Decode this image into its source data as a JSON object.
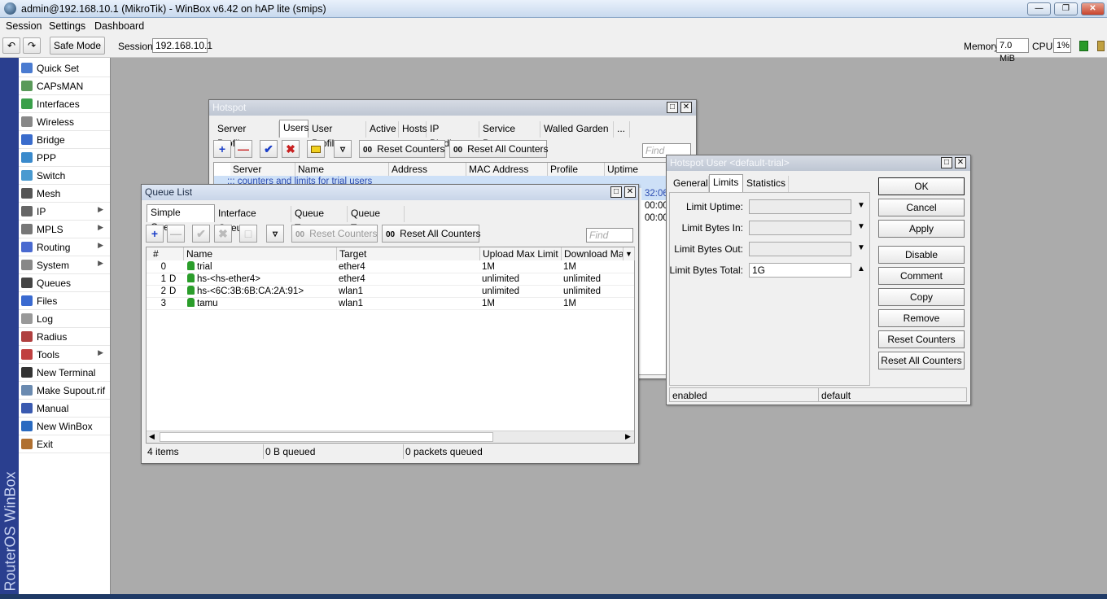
{
  "window": {
    "title": "admin@192.168.10.1 (MikroTik) - WinBox v6.42 on hAP lite (smips)"
  },
  "menu": [
    "Session",
    "Settings",
    "Dashboard"
  ],
  "toolbar": {
    "safe_mode": "Safe Mode",
    "session_label": "Session:",
    "session_value": "192.168.10.1",
    "memory_label": "Memory:",
    "memory_value": "7.0 MiB",
    "cpu_label": "CPU:",
    "cpu_value": "1%"
  },
  "side_brand": "RouterOS WinBox",
  "sidebar": [
    {
      "label": "Quick Set",
      "icon": "quickset-icon",
      "color": "#4a7bd0",
      "arrow": ""
    },
    {
      "label": "CAPsMAN",
      "icon": "capsman-icon",
      "color": "#5a9a5a",
      "arrow": ""
    },
    {
      "label": "Interfaces",
      "icon": "interfaces-icon",
      "color": "#3aa04a",
      "arrow": ""
    },
    {
      "label": "Wireless",
      "icon": "wireless-icon",
      "color": "#888888",
      "arrow": ""
    },
    {
      "label": "Bridge",
      "icon": "bridge-icon",
      "color": "#3a6ccc",
      "arrow": ""
    },
    {
      "label": "PPP",
      "icon": "ppp-icon",
      "color": "#3a8acc",
      "arrow": ""
    },
    {
      "label": "Switch",
      "icon": "switch-icon",
      "color": "#4a9ad0",
      "arrow": ""
    },
    {
      "label": "Mesh",
      "icon": "mesh-icon",
      "color": "#555555",
      "arrow": ""
    },
    {
      "label": "IP",
      "icon": "ip-icon",
      "color": "#666666",
      "arrow": "▶"
    },
    {
      "label": "MPLS",
      "icon": "mpls-icon",
      "color": "#777777",
      "arrow": "▶"
    },
    {
      "label": "Routing",
      "icon": "routing-icon",
      "color": "#4a6ad0",
      "arrow": "▶"
    },
    {
      "label": "System",
      "icon": "system-icon",
      "color": "#888888",
      "arrow": "▶"
    },
    {
      "label": "Queues",
      "icon": "queues-icon",
      "color": "#444444",
      "arrow": ""
    },
    {
      "label": "Files",
      "icon": "files-icon",
      "color": "#3a6ad0",
      "arrow": ""
    },
    {
      "label": "Log",
      "icon": "log-icon",
      "color": "#999999",
      "arrow": ""
    },
    {
      "label": "Radius",
      "icon": "radius-icon",
      "color": "#b04040",
      "arrow": ""
    },
    {
      "label": "Tools",
      "icon": "tools-icon",
      "color": "#c04040",
      "arrow": "▶"
    },
    {
      "label": "New Terminal",
      "icon": "terminal-icon",
      "color": "#333333",
      "arrow": ""
    },
    {
      "label": "Make Supout.rif",
      "icon": "supout-icon",
      "color": "#6a8ab0",
      "arrow": ""
    },
    {
      "label": "Manual",
      "icon": "manual-icon",
      "color": "#3a5ab0",
      "arrow": ""
    },
    {
      "label": "New WinBox",
      "icon": "winbox-icon",
      "color": "#2a6ac0",
      "arrow": ""
    },
    {
      "label": "Exit",
      "icon": "exit-icon",
      "color": "#b07030",
      "arrow": ""
    }
  ],
  "hotspot": {
    "title": "Hotspot",
    "tabs": [
      "Server Profiles",
      "Users",
      "User Profiles",
      "Active",
      "Hosts",
      "IP Bindings",
      "Service Ports",
      "Walled Garden",
      "..."
    ],
    "reset_counters": "Reset Counters",
    "reset_all_counters": "Reset All Counters",
    "find_placeholder": "Find",
    "columns": [
      "Server",
      "Name",
      "Address",
      "MAC Address",
      "Profile",
      "Uptime"
    ],
    "comment_row": ";;; counters and limits for trial users",
    "uptime_fragments": [
      "32:06",
      "00:00",
      "00:00"
    ]
  },
  "queue": {
    "title": "Queue List",
    "tabs": [
      "Simple Queues",
      "Interface Queues",
      "Queue Tree",
      "Queue Types"
    ],
    "reset_counters": "Reset Counters",
    "reset_all_counters": "Reset All Counters",
    "find_placeholder": "Find",
    "columns": [
      "#",
      "Name",
      "Target",
      "Upload Max Limit",
      "Download Max"
    ],
    "rows": [
      {
        "num": "0",
        "flag": "",
        "name": "trial",
        "target": "ether4",
        "up": "1M",
        "down": "1M"
      },
      {
        "num": "1",
        "flag": "D",
        "name": "hs-<hs-ether4>",
        "target": "ether4",
        "up": "unlimited",
        "down": "unlimited"
      },
      {
        "num": "2",
        "flag": "D",
        "name": "hs-<6C:3B:6B:CA:2A:91>",
        "target": "wlan1",
        "up": "unlimited",
        "down": "unlimited"
      },
      {
        "num": "3",
        "flag": "",
        "name": "tamu",
        "target": "wlan1",
        "up": "1M",
        "down": "1M"
      }
    ],
    "status": {
      "items": "4 items",
      "queued": "0 B queued",
      "packets": "0 packets queued"
    }
  },
  "user_dialog": {
    "title": "Hotspot User <default-trial>",
    "tabs": [
      "General",
      "Limits",
      "Statistics"
    ],
    "fields": [
      {
        "label": "Limit Uptime:",
        "value": ""
      },
      {
        "label": "Limit Bytes In:",
        "value": ""
      },
      {
        "label": "Limit Bytes Out:",
        "value": ""
      },
      {
        "label": "Limit Bytes Total:",
        "value": "1G"
      }
    ],
    "buttons": [
      "OK",
      "Cancel",
      "Apply",
      "Disable",
      "Comment",
      "Copy",
      "Remove",
      "Reset Counters",
      "Reset All Counters"
    ],
    "status_left": "enabled",
    "status_right": "default"
  }
}
